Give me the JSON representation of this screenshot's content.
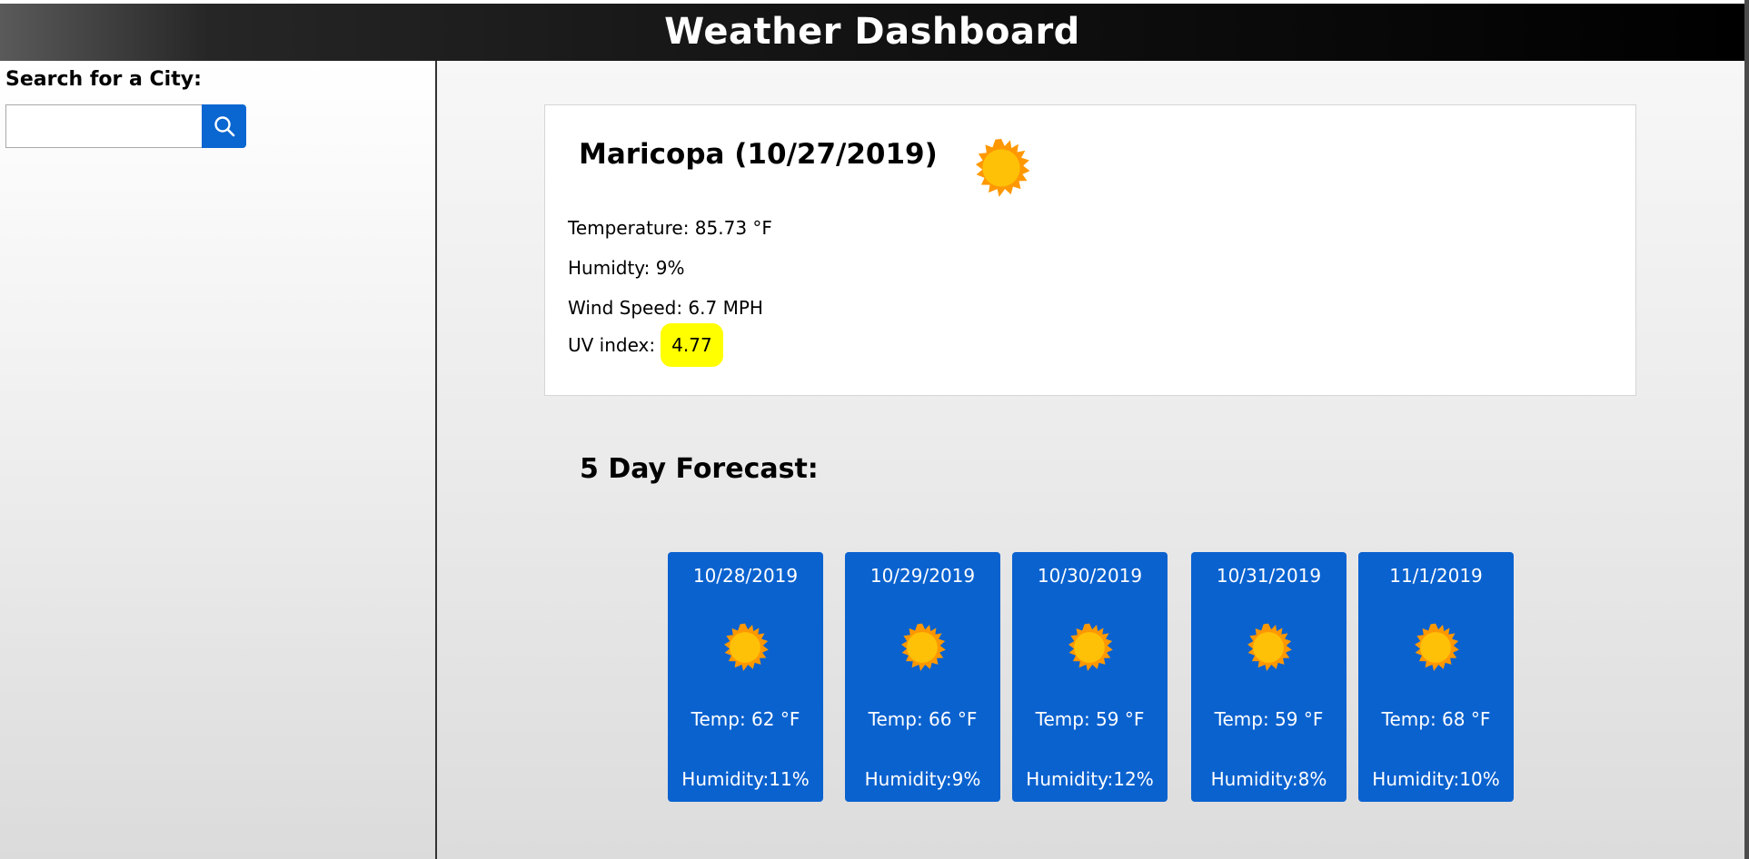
{
  "header": {
    "title": "Weather Dashboard"
  },
  "sidebar": {
    "search_label": "Search for a City:",
    "search_input_value": "",
    "search_button_icon": "search-icon"
  },
  "current": {
    "title": "Maricopa (10/27/2019)",
    "icon": "sun-icon",
    "temperature": "Temperature: 85.73 °F",
    "humidity": "Humidty: 9%",
    "wind": "Wind Speed: 6.7 MPH",
    "uv_label": "UV index:",
    "uv_value": "4.77"
  },
  "forecast": {
    "title": "5 Day Forecast:",
    "days": [
      {
        "date": "10/28/2019",
        "icon": "sun-icon",
        "temp": "Temp: 62 °F",
        "humidity": "Humidity:11%"
      },
      {
        "date": "10/29/2019",
        "icon": "sun-icon",
        "temp": "Temp: 66 °F",
        "humidity": "Humidity:9%"
      },
      {
        "date": "10/30/2019",
        "icon": "sun-icon",
        "temp": "Temp: 59 °F",
        "humidity": "Humidity:12%"
      },
      {
        "date": "10/31/2019",
        "icon": "sun-icon",
        "temp": "Temp: 59 °F",
        "humidity": "Humidity:8%"
      },
      {
        "date": "11/1/2019",
        "icon": "sun-icon",
        "temp": "Temp: 68 °F",
        "humidity": "Humidity:10%"
      }
    ]
  },
  "colors": {
    "header_bg": "#000000",
    "search_button": "#0a66d0",
    "forecast_card": "#0a62cf",
    "uv_highlight": "#ffff00",
    "sun": "#ffc107"
  }
}
